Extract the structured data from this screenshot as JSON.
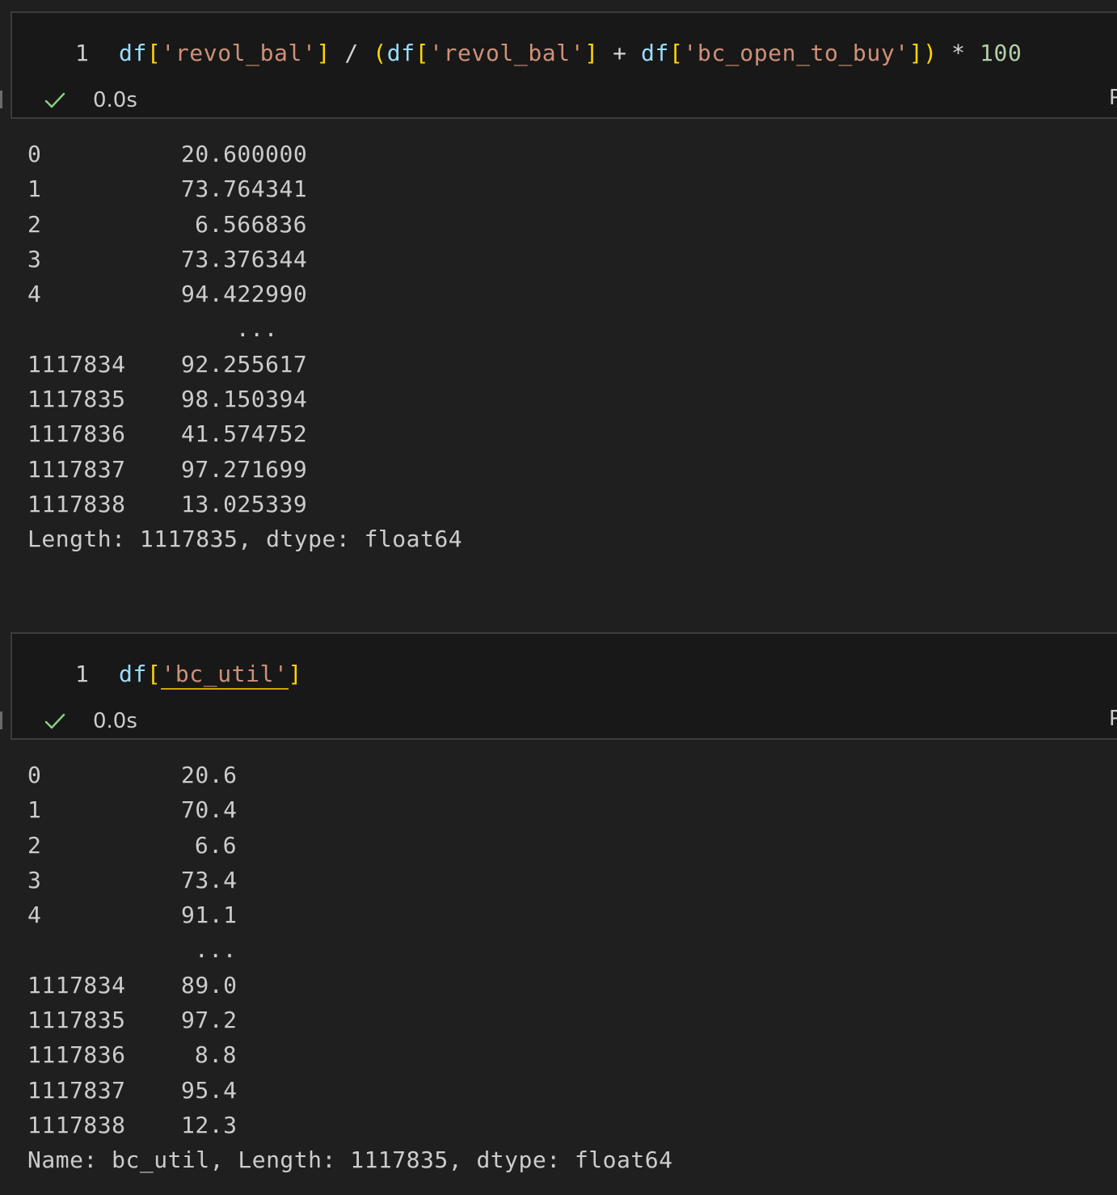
{
  "cells": [
    {
      "line_number": "1",
      "code_tokens": [
        {
          "text": "df",
          "kind": "var"
        },
        {
          "text": "[",
          "kind": "brk"
        },
        {
          "text": "'revol_bal'",
          "kind": "str"
        },
        {
          "text": "]",
          "kind": "brk"
        },
        {
          "text": " / ",
          "kind": "op"
        },
        {
          "text": "(",
          "kind": "brk"
        },
        {
          "text": "df",
          "kind": "var"
        },
        {
          "text": "[",
          "kind": "brk"
        },
        {
          "text": "'revol_bal'",
          "kind": "str"
        },
        {
          "text": "]",
          "kind": "brk"
        },
        {
          "text": " + ",
          "kind": "op"
        },
        {
          "text": "df",
          "kind": "var"
        },
        {
          "text": "[",
          "kind": "brk"
        },
        {
          "text": "'bc_open_to_buy'",
          "kind": "str"
        },
        {
          "text": "]",
          "kind": "brk"
        },
        {
          "text": ")",
          "kind": "brk"
        },
        {
          "text": " * ",
          "kind": "op"
        },
        {
          "text": "100",
          "kind": "num"
        }
      ],
      "status_icon": "check-icon",
      "duration": "0.0s",
      "output": {
        "rows_head": [
          {
            "index": "0",
            "value": "20.600000"
          },
          {
            "index": "1",
            "value": "73.764341"
          },
          {
            "index": "2",
            "value": "6.566836"
          },
          {
            "index": "3",
            "value": "73.376344"
          },
          {
            "index": "4",
            "value": "94.422990"
          }
        ],
        "ellipsis": "...",
        "rows_tail": [
          {
            "index": "1117834",
            "value": "92.255617"
          },
          {
            "index": "1117835",
            "value": "98.150394"
          },
          {
            "index": "1117836",
            "value": "41.574752"
          },
          {
            "index": "1117837",
            "value": "97.271699"
          },
          {
            "index": "1117838",
            "value": "13.025339"
          }
        ],
        "footer": "Length: 1117835, dtype: float64"
      }
    },
    {
      "line_number": "1",
      "code_tokens": [
        {
          "text": "df",
          "kind": "var"
        },
        {
          "text": "[",
          "kind": "brk"
        },
        {
          "text": "'bc_util'",
          "kind": "str",
          "squiggle": true
        },
        {
          "text": "]",
          "kind": "brk"
        }
      ],
      "status_icon": "check-icon",
      "duration": "0.0s",
      "output": {
        "rows_head": [
          {
            "index": "0",
            "value": "20.6"
          },
          {
            "index": "1",
            "value": "70.4"
          },
          {
            "index": "2",
            "value": "6.6"
          },
          {
            "index": "3",
            "value": "73.4"
          },
          {
            "index": "4",
            "value": "91.1"
          }
        ],
        "ellipsis": "...",
        "rows_tail": [
          {
            "index": "1117834",
            "value": "89.0"
          },
          {
            "index": "1117835",
            "value": "97.2"
          },
          {
            "index": "1117836",
            "value": "8.8"
          },
          {
            "index": "1117837",
            "value": "95.4"
          },
          {
            "index": "1117838",
            "value": "12.3"
          }
        ],
        "footer": "Name: bc_util, Length: 1117835, dtype: float64"
      }
    }
  ],
  "edge_label": "P",
  "colors": {
    "background": "#1f1f1f",
    "cell_background": "#181818",
    "variable": "#9cdcfe",
    "string": "#ce9178",
    "bracket": "#ffd700",
    "number": "#b5cea8",
    "success": "#89d185"
  }
}
